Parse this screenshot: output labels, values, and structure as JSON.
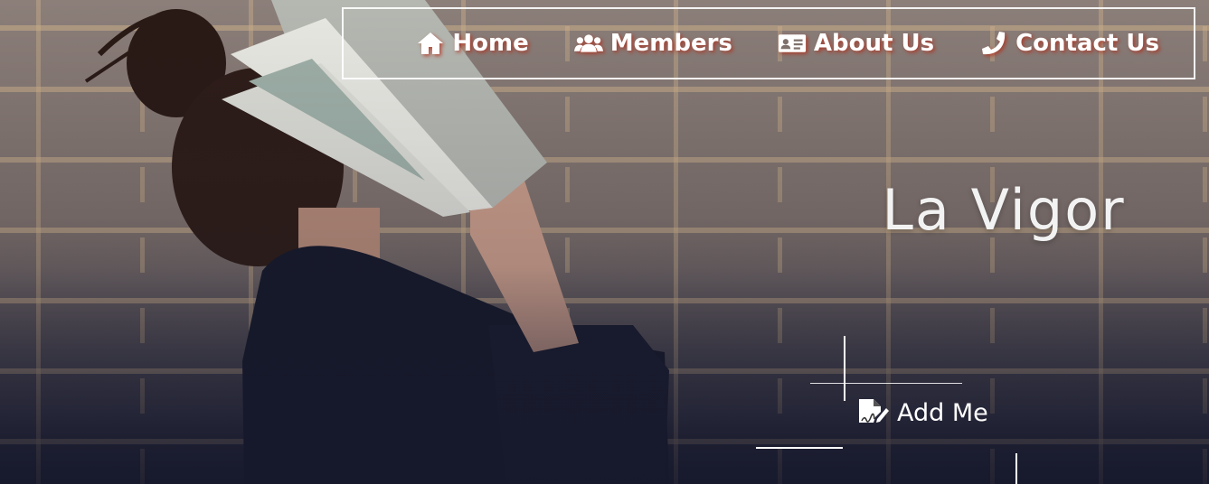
{
  "nav": {
    "items": [
      {
        "label": "Home",
        "icon": "home-icon"
      },
      {
        "label": "Members",
        "icon": "users-icon"
      },
      {
        "label": "About Us",
        "icon": "id-card-icon"
      },
      {
        "label": "Contact Us",
        "icon": "phone-icon"
      }
    ],
    "shadow_color": "#b42814"
  },
  "hero": {
    "title": "La Vigor",
    "add_button_label": "Add Me",
    "add_button_icon": "file-signature-icon"
  },
  "colors": {
    "text": "#ffffff",
    "nav_border": "#ffffff",
    "bottom_shade": "#1c1e30"
  }
}
